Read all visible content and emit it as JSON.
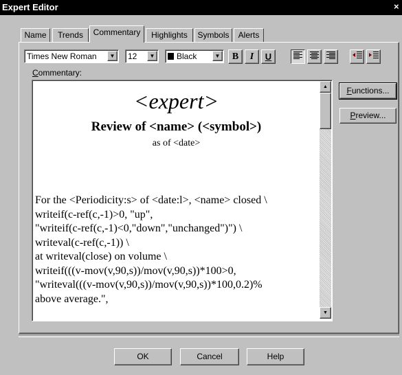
{
  "window": {
    "title": "Expert Editor",
    "close_glyph": "×"
  },
  "tabs": [
    {
      "label": "Name",
      "active": false
    },
    {
      "label": "Trends",
      "active": false
    },
    {
      "label": "Commentary",
      "active": true
    },
    {
      "label": "Highlights",
      "active": false
    },
    {
      "label": "Symbols",
      "active": false
    },
    {
      "label": "Alerts",
      "active": false
    }
  ],
  "toolbar": {
    "font": "Times New Roman",
    "size": "12",
    "color": "Black",
    "color_swatch": "#000000",
    "bold": "B",
    "italic": "I",
    "underline": "U",
    "align_icons": [
      "align-left-icon",
      "align-center-icon",
      "align-right-icon"
    ],
    "indent_icons": [
      "outdent-icon",
      "indent-icon"
    ],
    "active_alignment": "left"
  },
  "commentary": {
    "label": "Commentary:",
    "heading": "<expert>",
    "title": "Review of <name> (<symbol>)",
    "date_line": "as of <date>",
    "body_lines": [
      "For the <Periodicity:s> of <date:l>, <name> closed \\",
      "writeif(c-ref(c,-1)>0, \"up\",",
      "\"writeif(c-ref(c,-1)<0,\"down\",\"unchanged\")\") \\",
      "writeval(c-ref(c,-1)) \\",
      "at writeval(close) on volume \\",
      "writeif(((v-mov(v,90,s))/mov(v,90,s))*100>0,",
      "\"writeval(((v-mov(v,90,s))/mov(v,90,s))*100,0.2)%",
      "above average.\","
    ]
  },
  "side_buttons": {
    "functions": "Functions...",
    "preview": "Preview..."
  },
  "footer": {
    "ok": "OK",
    "cancel": "Cancel",
    "help": "Help"
  }
}
